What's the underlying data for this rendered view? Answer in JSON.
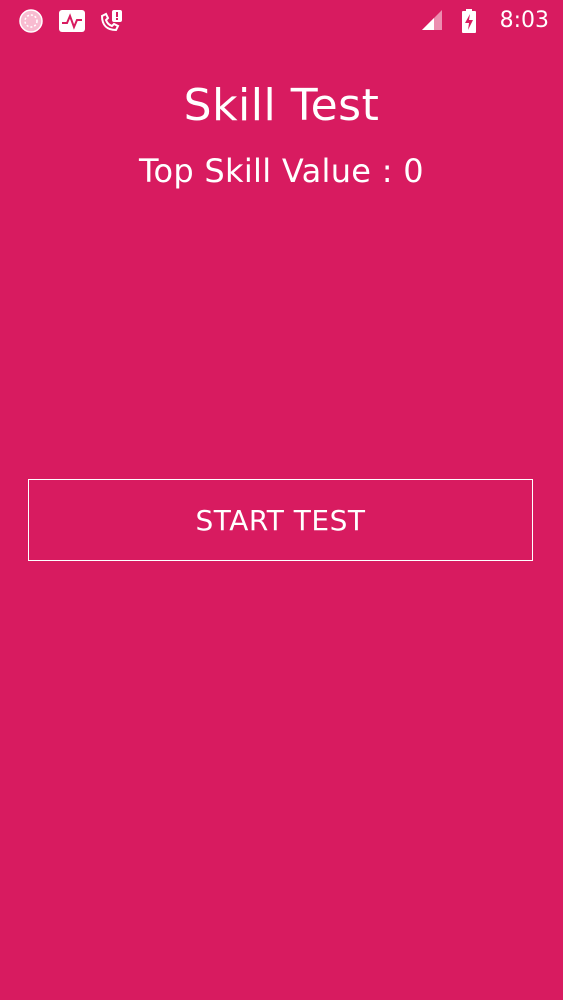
{
  "status_bar": {
    "time": "8:03",
    "icons_left": [
      "app-notification-icon",
      "activity-icon",
      "missed-call-icon"
    ],
    "icons_right": [
      "signal-icon",
      "battery-charging-icon"
    ]
  },
  "main": {
    "title": "Skill Test",
    "subtitle": "Top Skill Value : 0",
    "start_button_label": "START TEST"
  },
  "colors": {
    "background": "#d81b60",
    "foreground": "#ffffff"
  }
}
